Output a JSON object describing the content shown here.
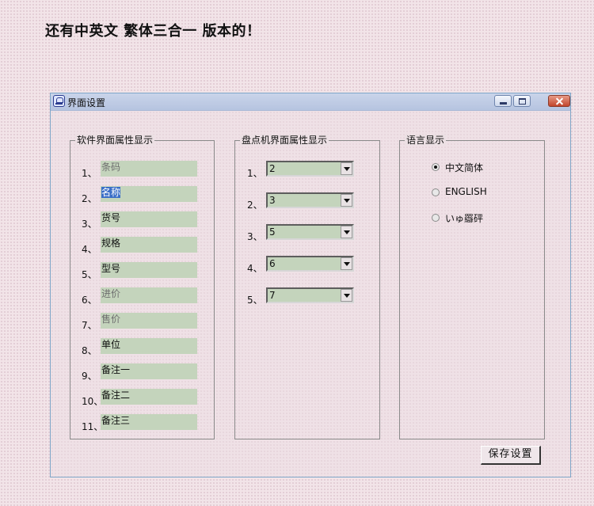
{
  "heading": "还有中英文 繁体三合一 版本的！",
  "window": {
    "title": "界面设置",
    "controls": {
      "minimize_icon": "minimize-icon",
      "maximize_icon": "maximize-icon",
      "close_icon": "close-icon"
    }
  },
  "software_group": {
    "title": "软件界面属性显示",
    "rows": [
      {
        "num": "1、",
        "value": "条码",
        "dim": true
      },
      {
        "num": "2、",
        "value": "名称",
        "selected": true
      },
      {
        "num": "3、",
        "value": "货号"
      },
      {
        "num": "4、",
        "value": "规格"
      },
      {
        "num": "5、",
        "value": "型号"
      },
      {
        "num": "6、",
        "value": "进价",
        "dim": true
      },
      {
        "num": "7、",
        "value": "售价",
        "dim": true
      },
      {
        "num": "8、",
        "value": "单位"
      },
      {
        "num": "9、",
        "value": "备注一"
      },
      {
        "num": "10、",
        "value": "备注二"
      },
      {
        "num": "11、",
        "value": "备注三"
      }
    ]
  },
  "device_group": {
    "title": "盘点机界面属性显示",
    "rows": [
      {
        "num": "1、",
        "value": "2"
      },
      {
        "num": "2、",
        "value": "3"
      },
      {
        "num": "3、",
        "value": "5"
      },
      {
        "num": "4、",
        "value": "6"
      },
      {
        "num": "5、",
        "value": "7"
      }
    ]
  },
  "language_group": {
    "title": "语言显示",
    "options": [
      {
        "label": "中文简体",
        "checked": true
      },
      {
        "label": "ENGLISH",
        "checked": false
      },
      {
        "label": "いゅ羉砰",
        "checked": false
      }
    ]
  },
  "save_button": "保存设置"
}
